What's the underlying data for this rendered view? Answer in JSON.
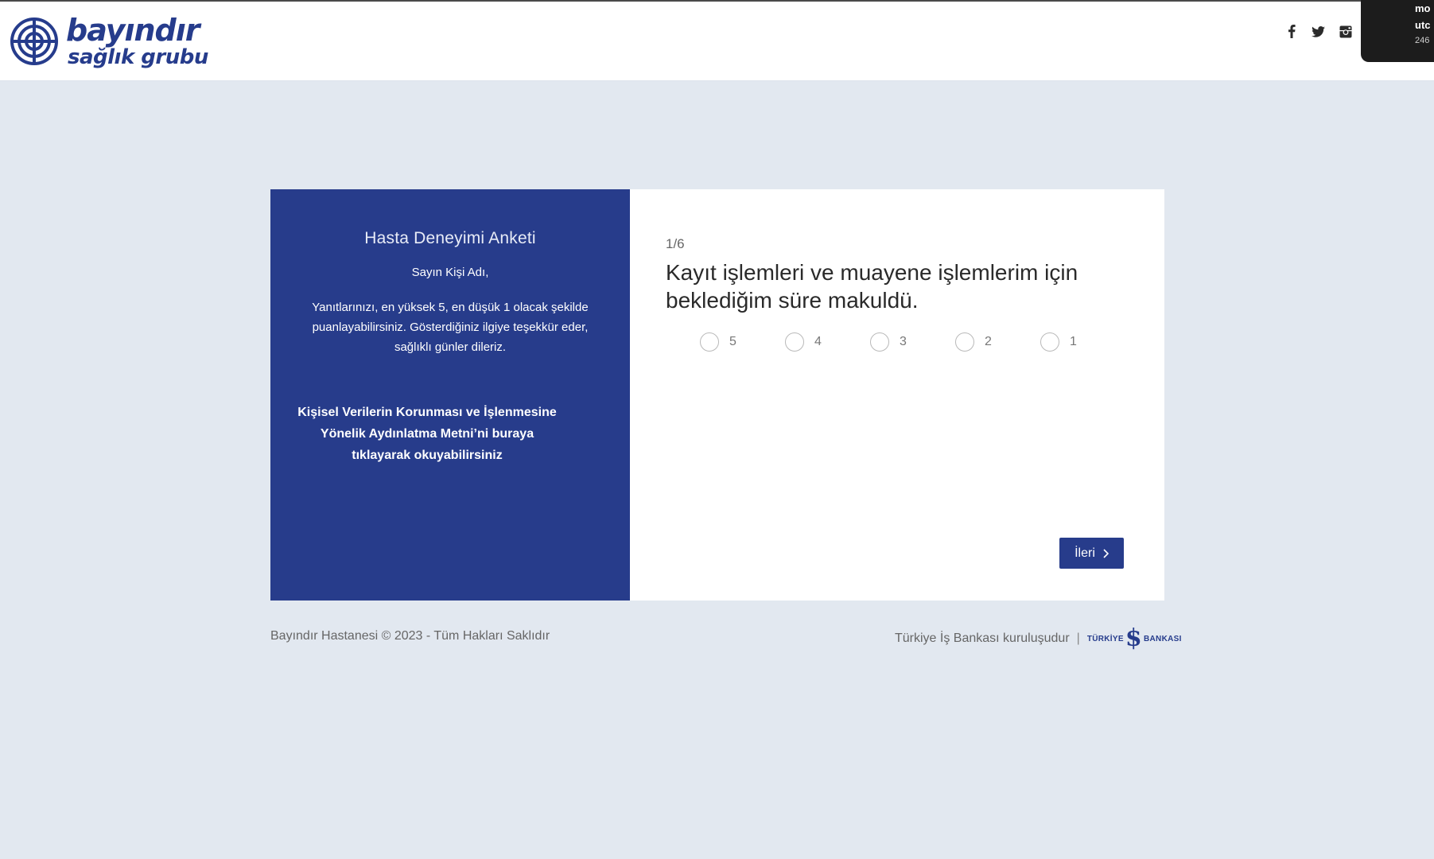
{
  "header": {
    "logo_line1": "bayındır",
    "logo_line2": "sağlık grubu",
    "social": [
      {
        "icon": "facebook-icon"
      },
      {
        "icon": "twitter-icon"
      },
      {
        "icon": "instagram-icon"
      }
    ]
  },
  "overlay": {
    "line1": "mo",
    "line2": "utc",
    "line3": "246"
  },
  "intro_panel": {
    "title": "Hasta Deneyimi Anketi",
    "greeting": "Sayın Kişi Adı,",
    "body": "Yanıtlarınızı, en yüksek 5, en düşük 1 olacak şekilde puanlayabilirsiniz. Gösterdiğiniz ilgiye teşekkür eder, sağlıklı günler dileriz.",
    "kvkk_link": "Kişisel Verilerin Korunması ve İşlenmesine Yönelik Aydınlatma Metni’ni buraya tıklayarak okuyabilirsiniz"
  },
  "question": {
    "progress": "1/6",
    "text": "Kayıt işlemleri ve muayene işlemlerim için beklediğim süre makuldü.",
    "options": [
      "5",
      "4",
      "3",
      "2",
      "1"
    ],
    "selected": null
  },
  "next_button": {
    "label": "İleri",
    "icon": "chevron-right-icon"
  },
  "footer": {
    "copyright": "Bayındır Hastanesi © 2023 - Tüm Hakları Saklıdır",
    "affiliation": "Türkiye İş Bankası kuruluşudur",
    "separator": "|",
    "bank_logo_left": "TÜRKİYE",
    "bank_logo_symbol": "$",
    "bank_logo_right": "BANKASI"
  },
  "colors": {
    "brand_blue": "#273c8b",
    "page_bg": "#e2e8f0"
  }
}
